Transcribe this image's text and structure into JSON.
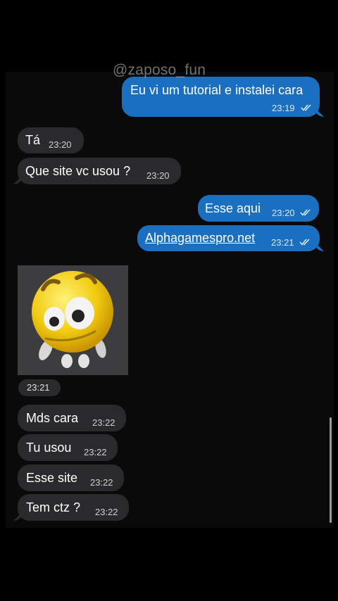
{
  "watermark": "@zaposo_fun",
  "messages": [
    {
      "text": "Eu vi um tutorial e instalei cara",
      "time": "23:19"
    },
    {
      "text": "Tá",
      "time": "23:20"
    },
    {
      "text": "Que site vc usou ?",
      "time": "23:20"
    },
    {
      "text": "Esse aqui",
      "time": "23:20"
    },
    {
      "text": "Alphagamespro.net",
      "time": "23:21"
    },
    {
      "text": "Mds cara",
      "time": "23:22"
    },
    {
      "text": "Tu usou",
      "time": "23:22"
    },
    {
      "text": "Esse site",
      "time": "23:22"
    },
    {
      "text": "Tem ctz ?",
      "time": "23:22"
    }
  ],
  "sticker": {
    "icon": "emoji-sticker-icon",
    "time": "23:21"
  },
  "colors": {
    "outgoing": "#1b6fc0",
    "incoming": "#2a2a2c",
    "background": "#0a0a0b"
  }
}
